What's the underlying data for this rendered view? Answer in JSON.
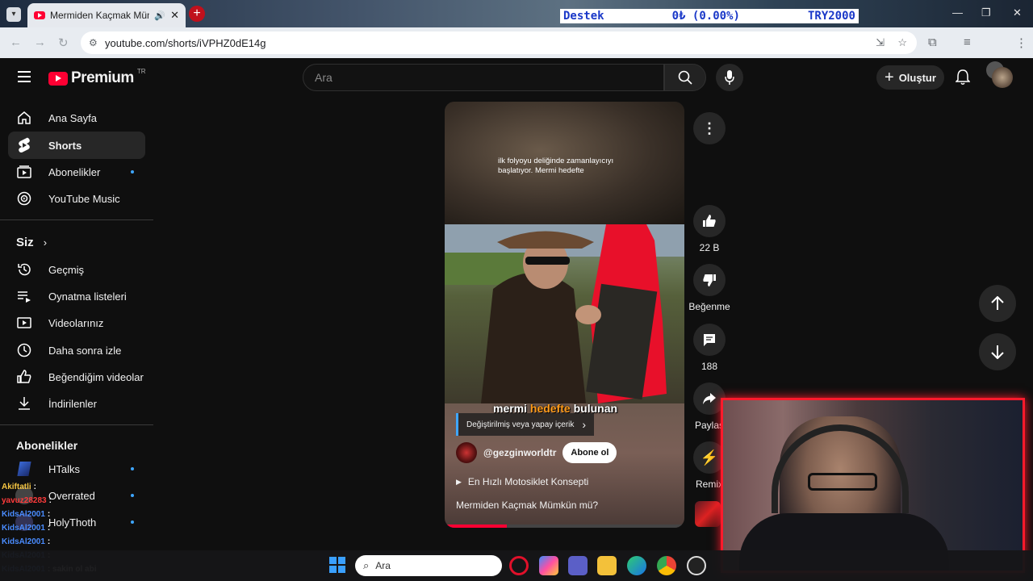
{
  "browser": {
    "tab_title": "Mermiden Kaçmak Mümkü",
    "url": "youtube.com/shorts/iVPHZ0dE14g",
    "ticker": {
      "label": "Destek",
      "amount": "0₺ (0.00%)",
      "goal": "TRY2000"
    }
  },
  "header": {
    "brand": "Premium",
    "region": "TR",
    "search_placeholder": "Ara",
    "create_label": "Oluştur"
  },
  "sidebar": {
    "main": [
      {
        "label": "Ana Sayfa",
        "icon": "home-icon"
      },
      {
        "label": "Shorts",
        "icon": "shorts-icon"
      },
      {
        "label": "Abonelikler",
        "icon": "subscriptions-icon"
      },
      {
        "label": "YouTube Music",
        "icon": "music-icon"
      }
    ],
    "you_title": "Siz",
    "you": [
      {
        "label": "Geçmiş",
        "icon": "history-icon"
      },
      {
        "label": "Oynatma listeleri",
        "icon": "playlist-icon"
      },
      {
        "label": "Videolarınız",
        "icon": "your-videos-icon"
      },
      {
        "label": "Daha sonra izle",
        "icon": "clock-icon"
      },
      {
        "label": "Beğendiğim videolar",
        "icon": "like-icon"
      },
      {
        "label": "İndirilenler",
        "icon": "download-icon"
      }
    ],
    "subs_title": "Abonelikler",
    "subs": [
      {
        "label": "HTalks"
      },
      {
        "label": "Overrated"
      },
      {
        "label": "HolyThoth"
      }
    ]
  },
  "short": {
    "subtitle": "ilk folyoyu deliğinde zamanlayıcıyı başlatıyor. Mermi hedefte",
    "caption_a": "mermi",
    "caption_hl": "hedefte",
    "caption_b": "bulunan",
    "ai_tag": "Değiştirilmiş veya yapay içerik",
    "channel": "@gezginworldtr",
    "subscribe": "Abone ol",
    "link": "En Hızlı Motosiklet Konsepti",
    "title": "Mermiden Kaçmak Mümkün mü?",
    "progress": 0.26
  },
  "actions": {
    "likes": "22 B",
    "dislike": "Beğenme",
    "comments": "188",
    "share": "Paylaş",
    "remix": "Remix"
  },
  "chat": [
    {
      "user": "Akiftatli",
      "msg": ":",
      "color": "#f5c542"
    },
    {
      "user": "yavuz28283",
      "msg": ":",
      "color": "#ff3b3b"
    },
    {
      "user": "KidsAl2001",
      "msg": ":",
      "color": "#4a8cff"
    },
    {
      "user": "KidsAl2001",
      "msg": ":",
      "color": "#4a8cff"
    },
    {
      "user": "KidsAl2001",
      "msg": ":",
      "color": "#4a8cff"
    },
    {
      "user": "KidsAl2001",
      "msg": ":",
      "color": "#4a8cff"
    },
    {
      "user": "KidsAl2001",
      "msg": ": sakin ol abi",
      "color": "#4a8cff"
    }
  ],
  "taskbar": {
    "search_placeholder": "Ara"
  }
}
